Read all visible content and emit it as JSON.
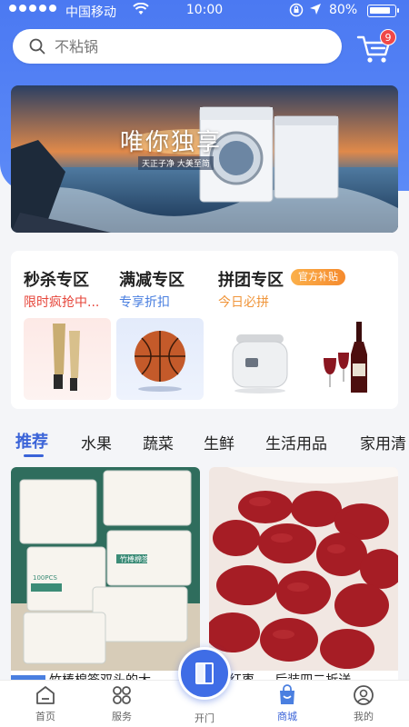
{
  "status_bar": {
    "carrier": "中国移动",
    "time": "10:00",
    "battery": "80%"
  },
  "search": {
    "placeholder": "不粘锅"
  },
  "cart": {
    "badge_count": "9"
  },
  "banner": {
    "title": "唯你独享",
    "subtitle": "天正子净 大美至简"
  },
  "promo": {
    "sections": [
      {
        "title": "秒杀专区",
        "subtitle": "限时疯抢中..."
      },
      {
        "title": "满减专区",
        "subtitle": "专享折扣"
      },
      {
        "title": "拼团专区",
        "subtitle": "今日必拼",
        "tag": "官方补贴"
      }
    ]
  },
  "tabs": [
    "推荐",
    "水果",
    "蔬菜",
    "生鲜",
    "生活用品",
    "家用清"
  ],
  "products": {
    "left_packaging_text": "竹棒棉签",
    "left_count_text": "100PCS",
    "caption_left": "竹棒棉签双头的大",
    "caption_right": "红枣 ... 后装四二折送"
  },
  "bottom_nav": {
    "items": [
      {
        "label": "首页"
      },
      {
        "label": "服务"
      },
      {
        "label": "开门"
      },
      {
        "label": "商城"
      },
      {
        "label": "我的"
      }
    ]
  },
  "colors": {
    "brand_blue": "#4b79f2",
    "active_tab": "#3a63d8",
    "badge_red": "#f04848",
    "tag_orange": "#f58a2e"
  }
}
